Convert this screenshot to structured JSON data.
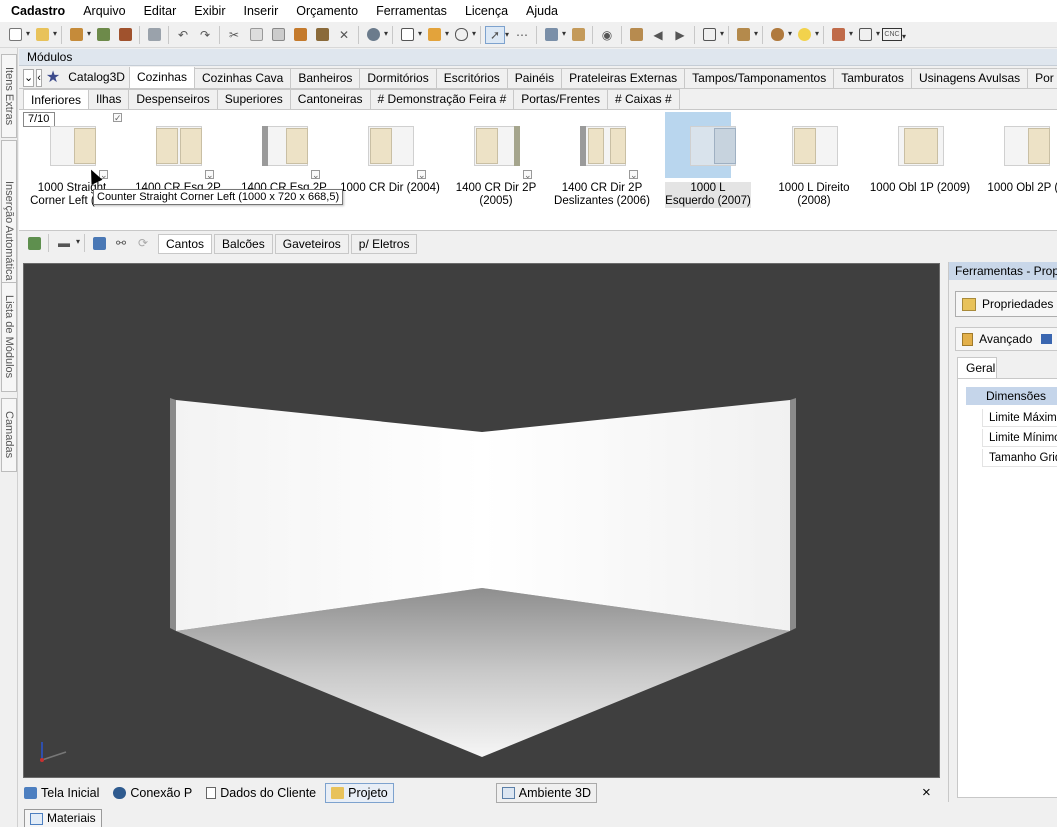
{
  "menu": [
    "Cadastro",
    "Arquivo",
    "Editar",
    "Exibir",
    "Inserir",
    "Orçamento",
    "Ferramentas",
    "Licença",
    "Ajuda"
  ],
  "left_strip": [
    "Itens Extras",
    "Inserção Automática",
    "Lista de Módulos",
    "Camadas"
  ],
  "modules_panel": {
    "title": "Módulos",
    "library": "Catalog3D",
    "categories": [
      "Cozinhas",
      "Cozinhas Cava",
      "Banheiros",
      "Dormitórios",
      "Escritórios",
      "Painéis",
      "Prateleiras Externas",
      "Tampos/Tamponamentos",
      "Tamburatos",
      "Usinagens Avulsas",
      "Por"
    ],
    "active_category": "Cozinhas",
    "subcategories": [
      "Inferiores",
      "Ilhas",
      "Despenseiros",
      "Superiores",
      "Cantoneiras",
      "# Demonstração Feira #",
      "Portas/Frentes",
      "# Caixas #"
    ],
    "active_subcategory": "Inferiores",
    "page_counter": "7/10",
    "items": [
      {
        "label": "1000 Straight Corner Left (200"
      },
      {
        "label": "1400 CR Esq 2P"
      },
      {
        "label": "1400 CR Esq 2P"
      },
      {
        "label": "1000 CR Dir (2004)"
      },
      {
        "label": "1400 CR Dir 2P (2005)"
      },
      {
        "label": "1400 CR Dir 2P Deslizantes (2006)"
      },
      {
        "label": "1000 L Esquerdo (2007)",
        "selected": true
      },
      {
        "label": "1000 L Direito (2008)"
      },
      {
        "label": "1000 Obl 1P (2009)"
      },
      {
        "label": "1000 Obl 2P (2"
      }
    ],
    "tooltip": "Counter Straight Corner Left (1000 x 720 x 668,5)",
    "filter_tabs": [
      "Cantos",
      "Balcões",
      "Gaveteiros",
      "p/ Eletros"
    ],
    "active_filter": "Cantos"
  },
  "bottom_tabs": [
    "Tela Inicial",
    "Conexão P",
    "Dados do Cliente",
    "Projeto",
    "Ambiente 3D"
  ],
  "active_bottom_tab": "Projeto",
  "close_symbol": "×",
  "materials_tab": "Materiais",
  "right_panel": {
    "title": "Ferramentas - Prop",
    "properties_button": "Propriedades",
    "advanced_button": "Avançado",
    "tab": "Geral",
    "section": "Dimensões",
    "rows": [
      "Limite Máximo",
      "Limite Mínimo",
      "Tamanho Grid"
    ]
  },
  "colors": {
    "viewport_bg": "#3f3f3f",
    "accent": "#c9d7e9",
    "selected_thumb": "#b9d6ee"
  }
}
